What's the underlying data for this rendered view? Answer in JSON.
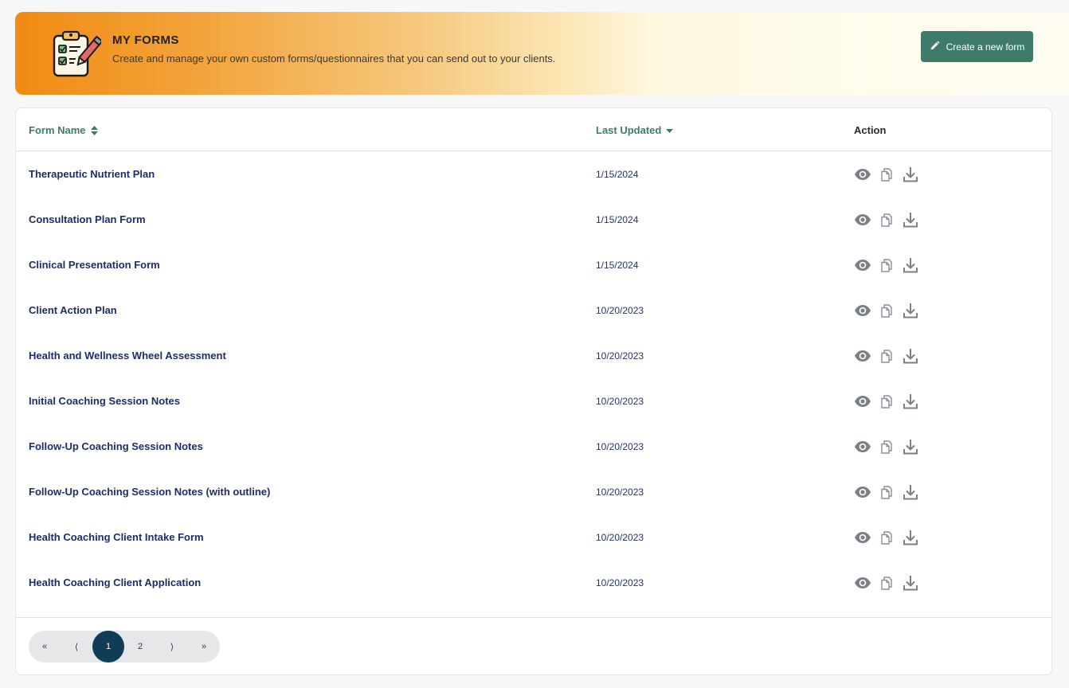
{
  "header": {
    "title": "MY FORMS",
    "subtitle": "Create and manage your own custom forms/questionnaires that you can send out to your clients.",
    "icon": "clipboard-checklist-icon",
    "create_button_label": "Create a new form",
    "create_button_icon": "pencil-icon"
  },
  "colors": {
    "accent": "#3f7b6a",
    "banner_start": "#f08b13",
    "banner_end": "#fffdf2",
    "link": "#1f2c6b",
    "pager_active": "#0e3d55"
  },
  "table": {
    "columns": {
      "name": "Form Name",
      "updated": "Last Updated",
      "action": "Action"
    },
    "sort": {
      "column": "updated",
      "direction": "desc"
    },
    "rows": [
      {
        "name": "Therapeutic Nutrient Plan",
        "updated": "1/15/2024"
      },
      {
        "name": "Consultation Plan Form",
        "updated": "1/15/2024"
      },
      {
        "name": "Clinical Presentation Form",
        "updated": "1/15/2024"
      },
      {
        "name": "Client Action Plan",
        "updated": "10/20/2023"
      },
      {
        "name": "Health and Wellness Wheel Assessment",
        "updated": "10/20/2023"
      },
      {
        "name": "Initial Coaching Session Notes",
        "updated": "10/20/2023"
      },
      {
        "name": "Follow-Up Coaching Session Notes",
        "updated": "10/20/2023"
      },
      {
        "name": "Follow-Up Coaching Session Notes (with outline)",
        "updated": "10/20/2023"
      },
      {
        "name": "Health Coaching Client Intake Form",
        "updated": "10/20/2023"
      },
      {
        "name": "Health Coaching Client Application",
        "updated": "10/20/2023"
      }
    ],
    "row_actions": [
      "view-icon",
      "copy-icon",
      "download-icon"
    ]
  },
  "pagination": {
    "first": "«",
    "prev": "⟨",
    "pages": [
      "1",
      "2"
    ],
    "current": "1",
    "next": "⟩",
    "last": "»"
  }
}
